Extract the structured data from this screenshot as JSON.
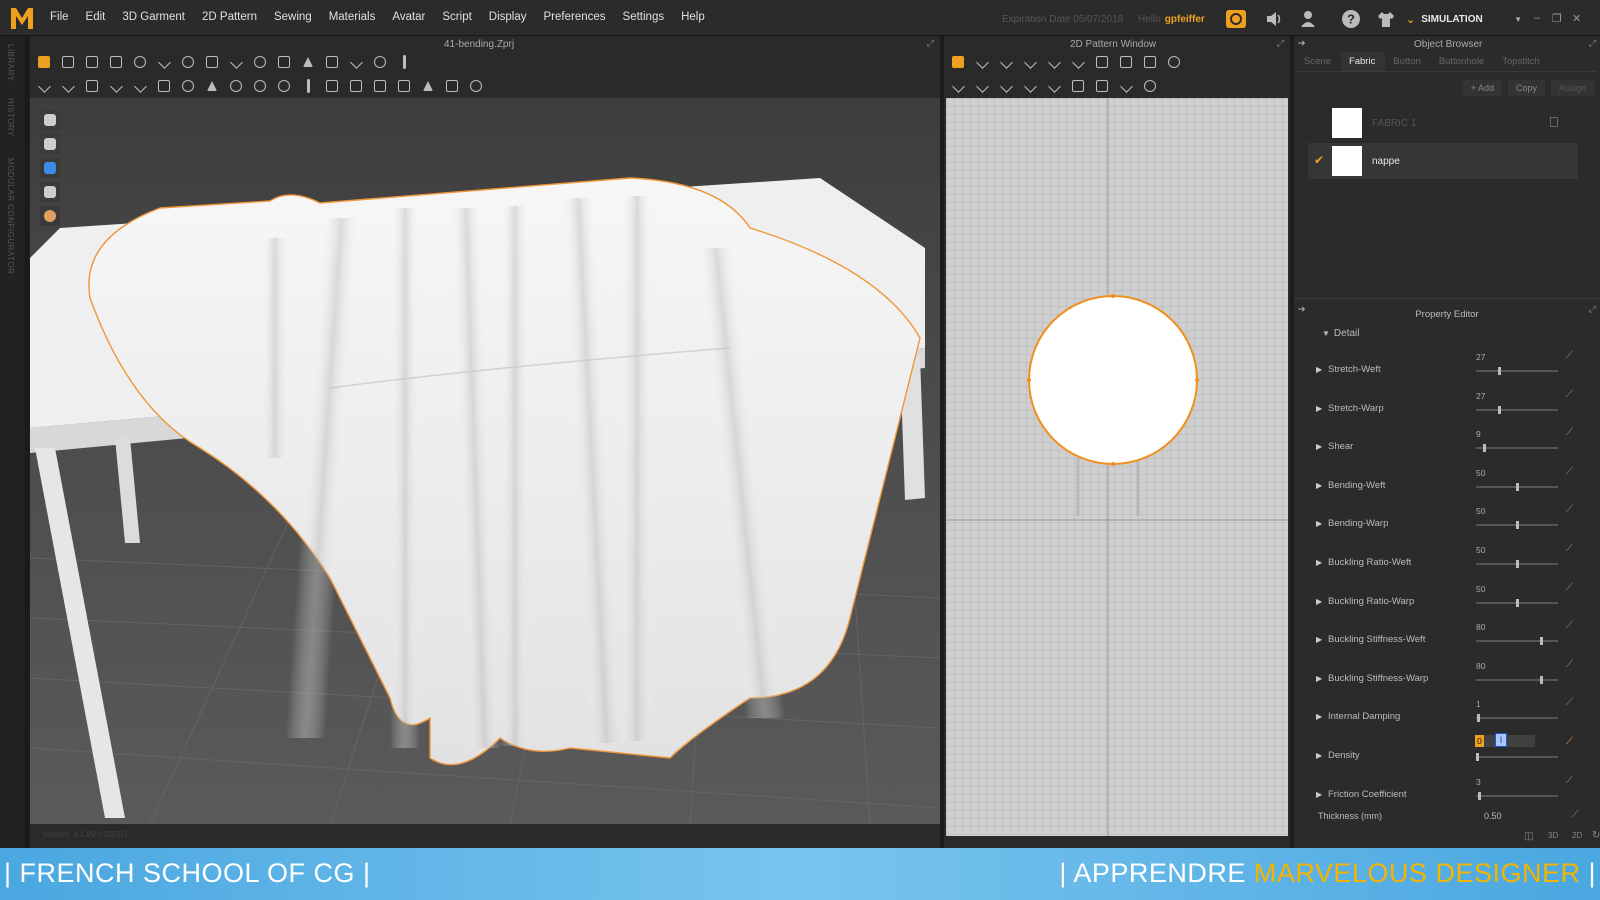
{
  "app": {
    "logo_letter": "M",
    "menu": [
      "File",
      "Edit",
      "3D Garment",
      "2D Pattern",
      "Sewing",
      "Materials",
      "Avatar",
      "Script",
      "Display",
      "Preferences",
      "Settings",
      "Help"
    ],
    "expiration": "Expiration Date 05/07/2018",
    "hello_label": "Hello",
    "user": "gpfeiffer",
    "mode": "SIMULATION",
    "accent_color": "#f0a020"
  },
  "left_strip": [
    "LIBRARY",
    "HISTORY",
    "MODULAR CONFIGURATOR"
  ],
  "view3d": {
    "file_title": "41-bending.Zprj",
    "version": "Version: 4.1.99 (r32511)"
  },
  "view2d": {
    "title": "2D Pattern Window"
  },
  "object_browser": {
    "title": "Object Browser",
    "tabs": [
      "Scene",
      "Fabric",
      "Button",
      "Buttonhole",
      "Topstitch"
    ],
    "active_tab": "Fabric",
    "actions": [
      "+ Add",
      "Copy",
      "Assign"
    ],
    "fabrics": [
      {
        "name": "FABRIC 1",
        "selected": false
      },
      {
        "name": "nappe",
        "selected": true
      }
    ]
  },
  "property_editor": {
    "title": "Property Editor",
    "section": "Detail",
    "properties": [
      {
        "label": "Stretch-Weft",
        "value": "27",
        "fraction": 0.27
      },
      {
        "label": "Stretch-Warp",
        "value": "27",
        "fraction": 0.27
      },
      {
        "label": "Shear",
        "value": "9",
        "fraction": 0.09
      },
      {
        "label": "Bending-Weft",
        "value": "50",
        "fraction": 0.5
      },
      {
        "label": "Bending-Warp",
        "value": "50",
        "fraction": 0.5
      },
      {
        "label": "Buckling Ratio-Weft",
        "value": "50",
        "fraction": 0.5
      },
      {
        "label": "Buckling Ratio-Warp",
        "value": "50",
        "fraction": 0.5
      },
      {
        "label": "Buckling Stiffness-Weft",
        "value": "80",
        "fraction": 0.8
      },
      {
        "label": "Buckling Stiffness-Warp",
        "value": "80",
        "fraction": 0.8
      },
      {
        "label": "Internal Damping",
        "value": "1",
        "fraction": 0.01
      },
      {
        "label": "Density",
        "value": "0",
        "fraction": 0.0,
        "editing": true
      },
      {
        "label": "Friction Coefficient",
        "value": "3",
        "fraction": 0.03
      }
    ],
    "thickness_label": "Thickness (mm)",
    "thickness_value": "0.50"
  },
  "banner": {
    "left": "| FRENCH SCHOOL OF CG |",
    "right_prefix": "| APPRENDRE ",
    "right_highlight": "MARVELOUS DESIGNER",
    "right_suffix": " |"
  }
}
